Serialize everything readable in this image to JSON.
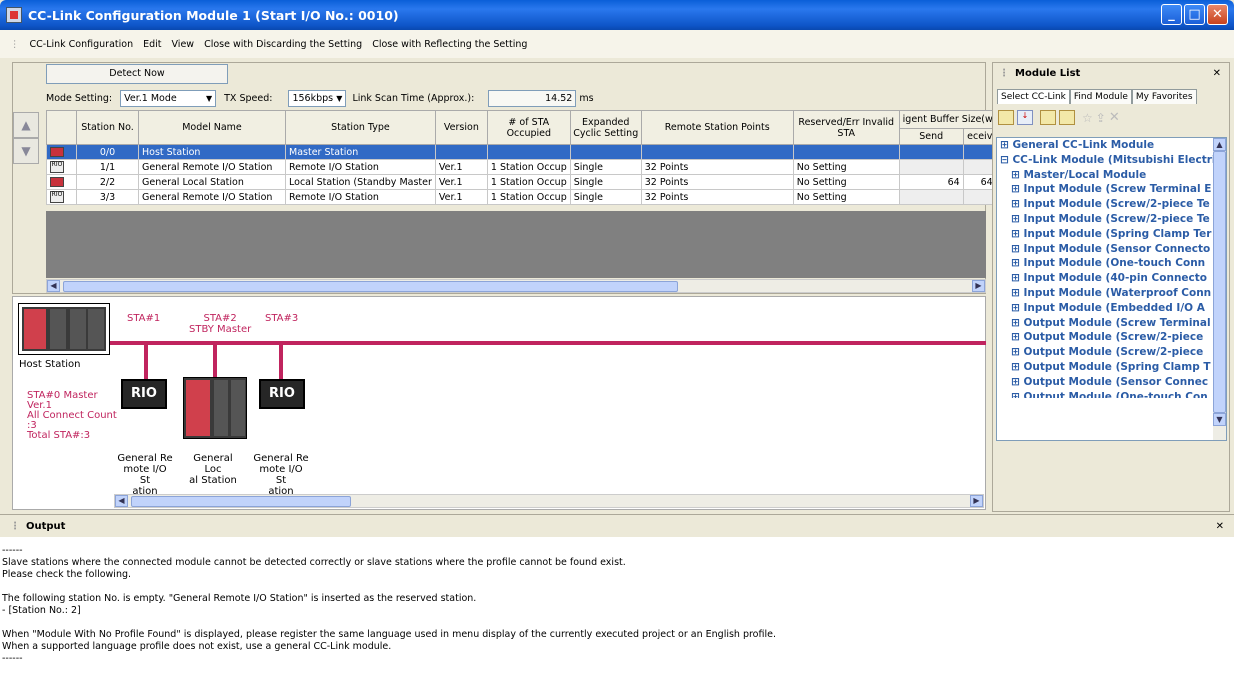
{
  "window": {
    "title": "CC-Link Configuration Module 1 (Start I/O No.: 0010)"
  },
  "menu": [
    "CC-Link Configuration",
    "Edit",
    "View",
    "Close with Discarding the Setting",
    "Close with Reflecting the Setting"
  ],
  "toolbar": {
    "detect_label": "Detect Now",
    "mode_label": "Mode Setting:",
    "mode_value": "Ver.1 Mode",
    "tx_label": "TX Speed:",
    "tx_value": "156kbps",
    "scan_label": "Link Scan Time (Approx.):",
    "scan_value": "14.52",
    "scan_unit": "ms"
  },
  "table": {
    "headers": [
      "Station No.",
      "Model Name",
      "Station Type",
      "Version",
      "# of STA Occupied",
      "Expanded Cyclic Setting",
      "Remote Station Points",
      "Reserved/Err Invalid STA",
      "igent Buffer Size(w",
      "Send",
      "eceiv"
    ],
    "rows": [
      {
        "icon": "host",
        "no": "0/0",
        "model": "Host Station",
        "type": "Master Station",
        "ver": "",
        "occ": "",
        "cyc": "",
        "points": "",
        "reserved": "",
        "send": "",
        "recv": ""
      },
      {
        "icon": "rio",
        "no": "1/1",
        "model": "General Remote I/O Station",
        "type": "Remote I/O Station",
        "ver": "Ver.1",
        "occ": "1 Station Occup",
        "cyc": "Single",
        "points": "32 Points",
        "reserved": "No Setting",
        "send": "",
        "recv": ""
      },
      {
        "icon": "local",
        "no": "2/2",
        "model": "General Local Station",
        "type": "Local Station (Standby Master",
        "ver": "Ver.1",
        "occ": "1 Station Occup",
        "cyc": "Single",
        "points": "32 Points",
        "reserved": "No Setting",
        "send": "64",
        "recv": "64"
      },
      {
        "icon": "rio",
        "no": "3/3",
        "model": "General Remote I/O Station",
        "type": "Remote I/O Station",
        "ver": "Ver.1",
        "occ": "1 Station Occup",
        "cyc": "Single",
        "points": "32 Points",
        "reserved": "No Setting",
        "send": "",
        "recv": ""
      }
    ]
  },
  "diagram": {
    "host_label": "Host Station",
    "sta1": "STA#1",
    "sta2": "STA#2",
    "sta2_sub": "STBY Master",
    "sta3": "STA#3",
    "info": [
      "STA#0 Master",
      "Ver.1",
      "All Connect Count",
      ":3",
      "Total STA#:3"
    ],
    "rio_text": "RIO",
    "names": [
      "General Re\nmote I/O St\nation",
      "General Loc\nal Station",
      "General Re\nmote I/O St\nation"
    ]
  },
  "module_list": {
    "title": "Module List",
    "tabs": [
      "Select CC-Link",
      "Find Module",
      "My Favorites"
    ],
    "items": [
      "⊞ General CC-Link Module",
      "⊟ CC-Link Module (Mitsubishi Electri",
      "⊞ Master/Local Module",
      "⊞ Input Module (Screw Terminal E",
      "⊞ Input Module (Screw/2-piece Te",
      "⊞ Input Module (Screw/2-piece Te",
      "⊞ Input Module (Spring Clamp Ter",
      "⊞ Input Module (Sensor Connecto",
      "⊞ Input Module (One-touch Conn",
      "⊞ Input Module (40-pin Connecto",
      "⊞ Input Module (Waterproof Conn",
      "⊞ Input Module (Embedded I/O A",
      "⊞ Output Module (Screw Terminal",
      "⊞ Output Module (Screw/2-piece",
      "⊞ Output Module (Screw/2-piece",
      "⊞ Output Module (Spring Clamp T",
      "⊞ Output Module (Sensor Connec",
      "⊞ Output Module (One-touch Con"
    ]
  },
  "output": {
    "title": "Output",
    "text": "------\nSlave stations where the connected module cannot be detected correctly or slave stations where the profile cannot be found exist.\nPlease check the following.\n\nThe following station No. is empty. \"General Remote I/O Station\" is inserted as the reserved station.\n- [Station No.: 2]\n\nWhen \"Module With No Profile Found\" is displayed, please register the same language used in menu display of the currently executed project or an English profile.\nWhen a supported language profile does not exist, use a general CC-Link module.\n------"
  },
  "colors": {
    "title_bar": "#0a5fd8",
    "selection": "#316ac5",
    "station_label": "#c0245e",
    "tree_text": "#2b5ca6"
  }
}
